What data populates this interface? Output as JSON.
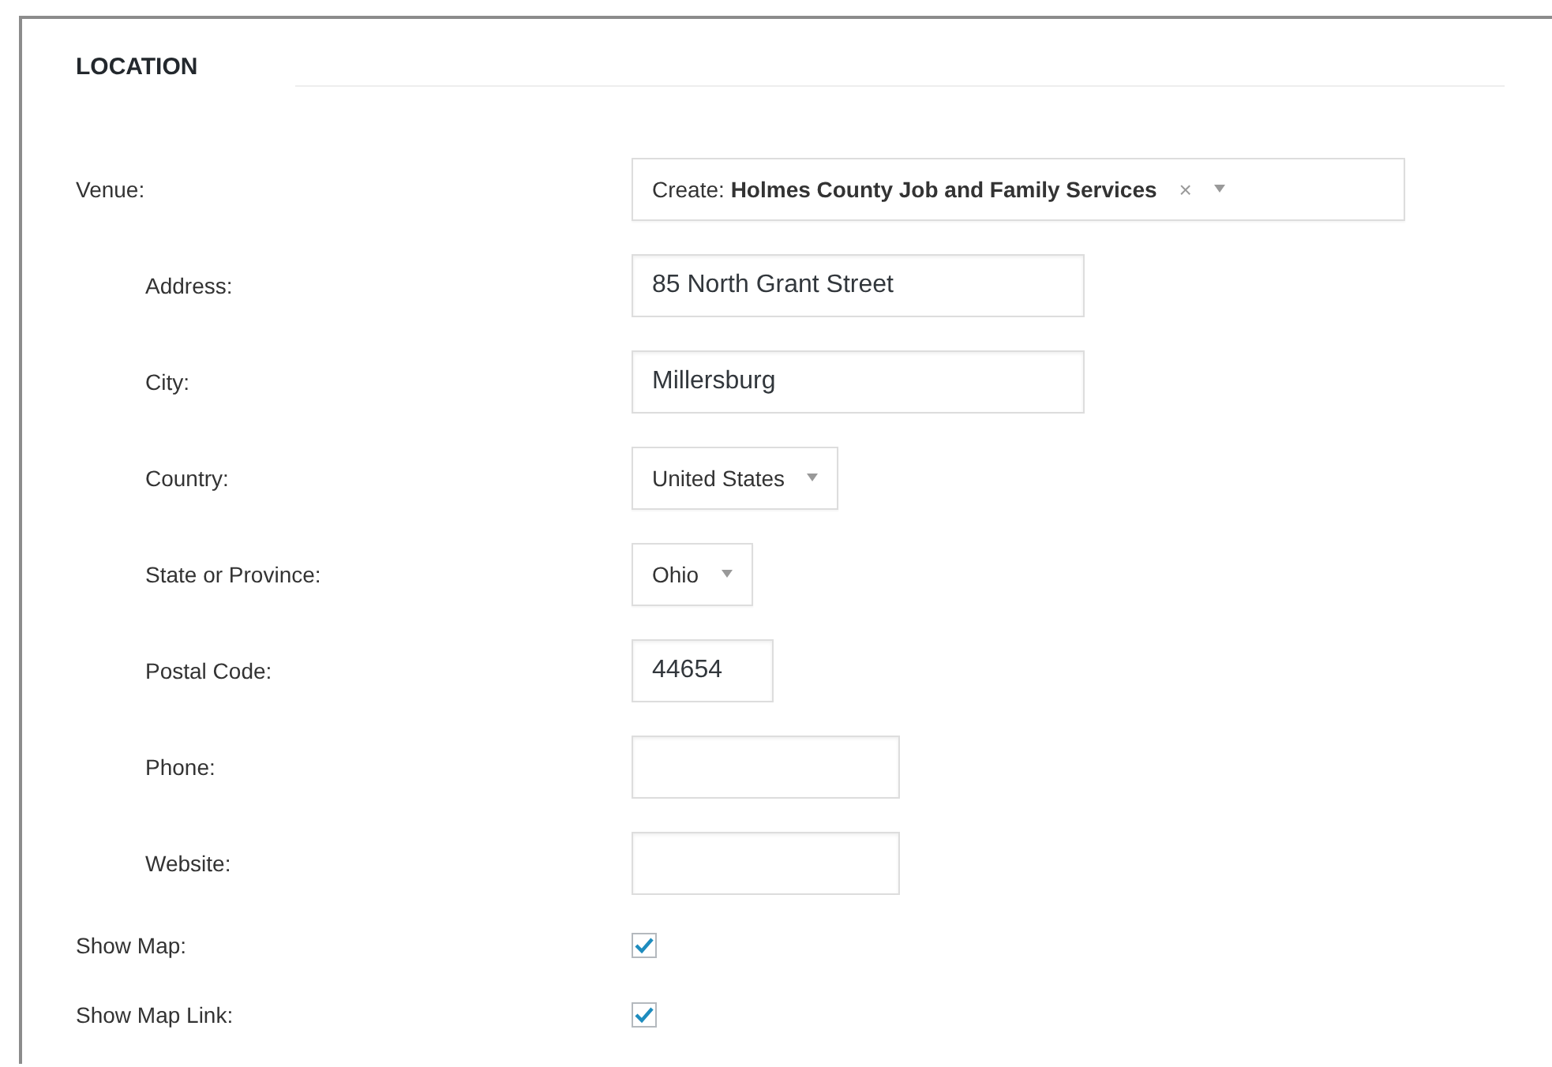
{
  "section": {
    "title": "LOCATION"
  },
  "fields": [
    {
      "label": "Venue:",
      "kind": "combo",
      "indented": false,
      "value": "Create: **Holmes County Job and Family Services**",
      "clear": "×"
    },
    {
      "label": "Address:",
      "kind": "text",
      "indented": true,
      "value": "85 North Grant Street"
    },
    {
      "label": "City:",
      "kind": "text",
      "indented": true,
      "value": "Millersburg"
    },
    {
      "label": "Country:",
      "kind": "select",
      "indented": true,
      "value": "United States"
    },
    {
      "label": "State or Province:",
      "kind": "select",
      "indented": true,
      "value": "Ohio"
    },
    {
      "label": "Postal Code:",
      "kind": "postcode",
      "indented": true,
      "value": "44654"
    },
    {
      "label": "Phone:",
      "kind": "partial",
      "indented": true
    },
    {
      "label": "Website:",
      "kind": "partial",
      "indented": true
    },
    {
      "label": "Show Map:",
      "kind": "checkbox",
      "indented": false,
      "checked": true
    },
    {
      "label": "Show Map Link:",
      "kind": "checkbox",
      "indented": false,
      "checked": true
    }
  ]
}
